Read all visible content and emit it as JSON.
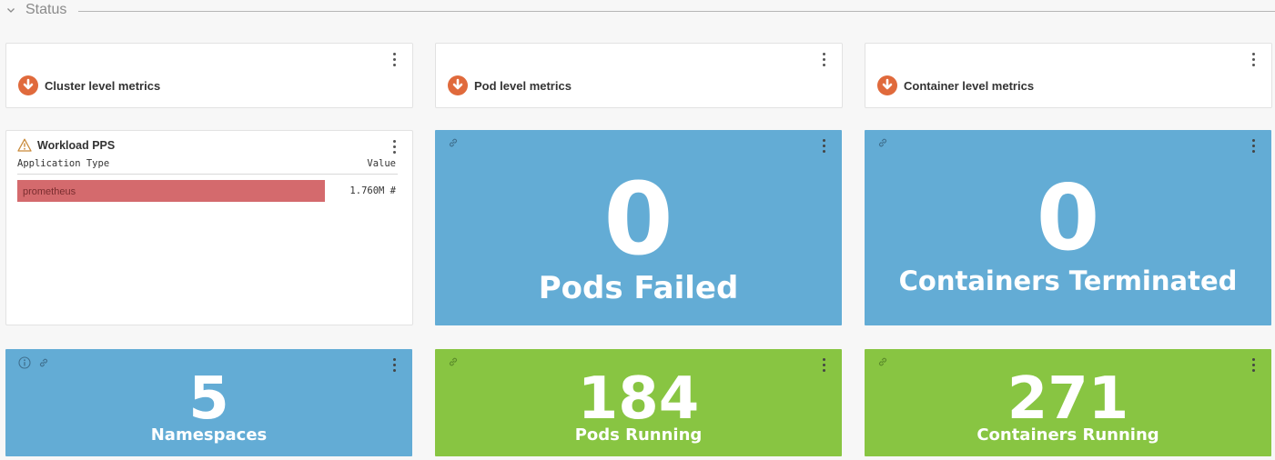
{
  "section": {
    "title": "Status"
  },
  "metric_panels": [
    {
      "label": "Cluster level metrics"
    },
    {
      "label": "Pod level metrics"
    },
    {
      "label": "Container level metrics"
    }
  ],
  "workload": {
    "title": "Workload PPS",
    "col_type": "Application Type",
    "col_value": "Value",
    "rows": [
      {
        "name": "prometheus",
        "value": "1.760M #",
        "fill_fraction": 1.0
      }
    ]
  },
  "tiles": {
    "pods_failed": {
      "value": "0",
      "label": "Pods Failed"
    },
    "containers_terminated": {
      "value": "0",
      "label": "Containers Terminated"
    },
    "namespaces": {
      "value": "5",
      "label": "Namespaces"
    },
    "pods_running": {
      "value": "184",
      "label": "Pods Running"
    },
    "containers_running": {
      "value": "271",
      "label": "Containers Running"
    }
  },
  "colors": {
    "tile_blue": "#63acd5",
    "tile_green": "#88c542",
    "alert_orange": "#e06a3c",
    "bar_red": "#d46a6d",
    "warning_icon": "#c98a3a"
  },
  "icons": [
    "chevron-down-icon",
    "arrow-down-circle-icon",
    "warning-icon",
    "link-icon",
    "info-icon",
    "kebab-menu-icon"
  ]
}
